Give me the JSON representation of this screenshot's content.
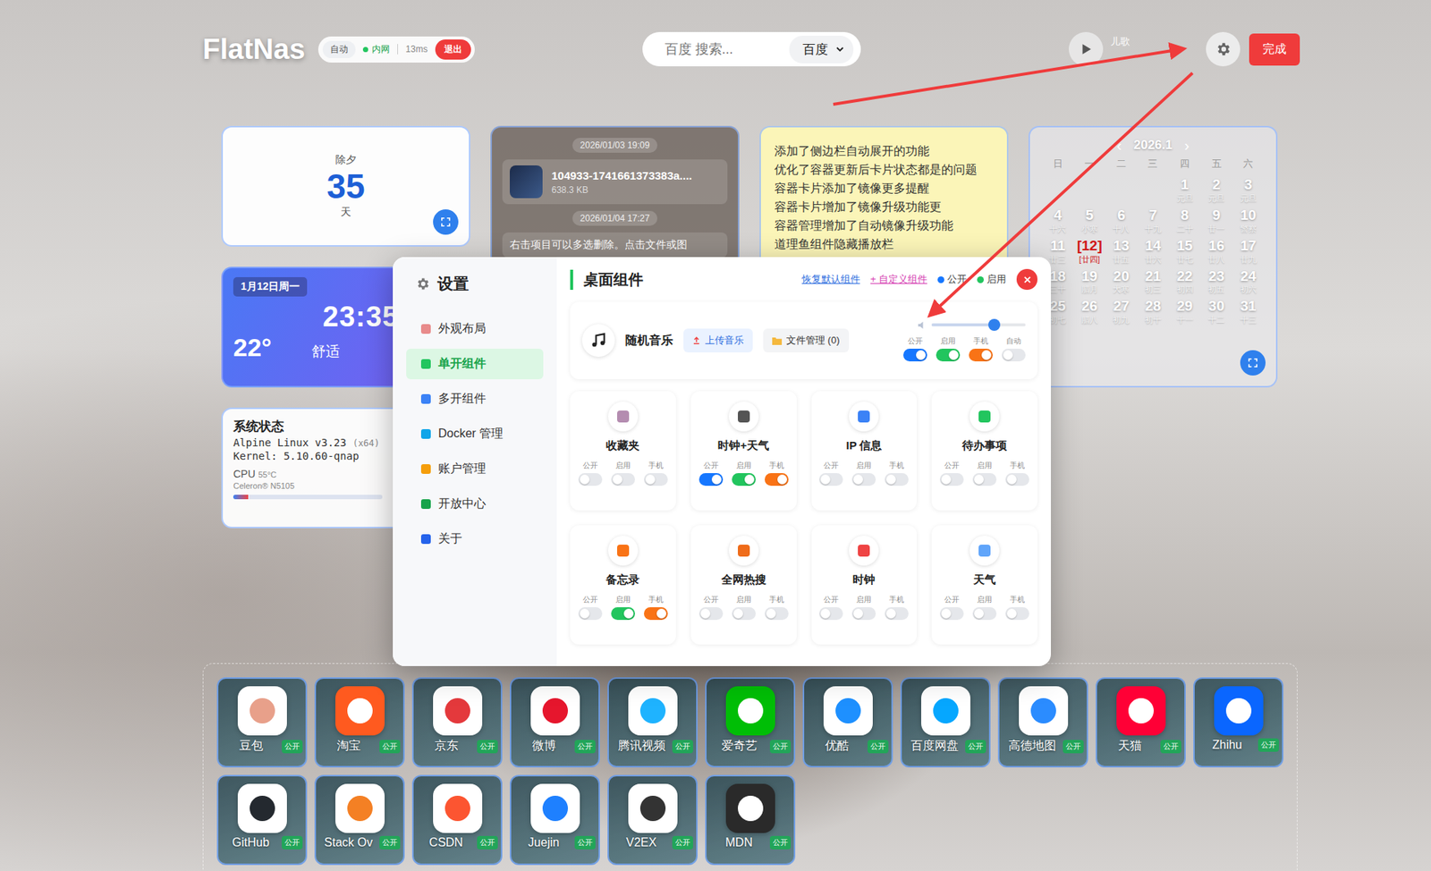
{
  "header": {
    "logo": "FlatNas",
    "status": {
      "mode": "自动",
      "network": "内网",
      "latency": "13ms",
      "logout": "退出"
    },
    "search": {
      "placeholder": "百度 搜索...",
      "engine": "百度"
    },
    "player": {
      "title": "儿歌"
    },
    "done": "完成"
  },
  "countdown": {
    "label": "除夕",
    "days": "35",
    "unit": "天"
  },
  "files": {
    "entries": [
      {
        "kind": "time",
        "text": "2026/01/03 19:09"
      },
      {
        "kind": "file",
        "text": "104933-1741661373383a....",
        "size": "638.3 KB"
      },
      {
        "kind": "time",
        "text": "2026/01/04 17:27"
      },
      {
        "kind": "message",
        "text": "右击项目可以多选删除。点击文件或图"
      }
    ]
  },
  "memo": {
    "lines": [
      "添加了侧边栏自动展开的功能",
      "优化了容器更新后卡片状态都是的问题",
      "容器卡片添加了镜像更多提醒",
      "容器卡片增加了镜像升级功能更",
      "容器管理增加了自动镜像升级功能",
      "道理鱼组件隐藏播放栏"
    ]
  },
  "calendar": {
    "title": "2026.1",
    "prev": "‹",
    "next": "›",
    "weekdays": [
      "日",
      "一",
      "二",
      "三",
      "四",
      "五",
      "六"
    ],
    "offset": 4,
    "days": [
      {
        "day": "1",
        "lunar": "元旦",
        "today": false
      },
      {
        "day": "2",
        "lunar": "元旦",
        "today": false
      },
      {
        "day": "3",
        "lunar": "元旦",
        "today": false
      },
      {
        "day": "4",
        "lunar": "十六",
        "today": false
      },
      {
        "day": "5",
        "lunar": "小寒",
        "today": false
      },
      {
        "day": "6",
        "lunar": "十八",
        "today": false
      },
      {
        "day": "7",
        "lunar": "十九",
        "today": false
      },
      {
        "day": "8",
        "lunar": "二十",
        "today": false
      },
      {
        "day": "9",
        "lunar": "廿一",
        "today": false
      },
      {
        "day": "10",
        "lunar": "警察",
        "today": false
      },
      {
        "day": "11",
        "lunar": "廿三",
        "today": false
      },
      {
        "day": "[12]",
        "lunar": "[廿四]",
        "today": true
      },
      {
        "day": "13",
        "lunar": "廿五",
        "today": false
      },
      {
        "day": "14",
        "lunar": "廿六",
        "today": false
      },
      {
        "day": "15",
        "lunar": "廿七",
        "today": false
      },
      {
        "day": "16",
        "lunar": "廿八",
        "today": false
      },
      {
        "day": "17",
        "lunar": "廿九",
        "today": false
      },
      {
        "day": "18",
        "lunar": "三十",
        "today": false
      },
      {
        "day": "19",
        "lunar": "腊月",
        "today": false
      },
      {
        "day": "20",
        "lunar": "大寒",
        "today": false
      },
      {
        "day": "21",
        "lunar": "初三",
        "today": false
      },
      {
        "day": "22",
        "lunar": "初四",
        "today": false
      },
      {
        "day": "23",
        "lunar": "初五",
        "today": false
      },
      {
        "day": "24",
        "lunar": "初六",
        "today": false
      },
      {
        "day": "25",
        "lunar": "初七",
        "today": false
      },
      {
        "day": "26",
        "lunar": "腊八",
        "today": false
      },
      {
        "day": "27",
        "lunar": "初九",
        "today": false
      },
      {
        "day": "28",
        "lunar": "初十",
        "today": false
      },
      {
        "day": "29",
        "lunar": "十一",
        "today": false
      },
      {
        "day": "30",
        "lunar": "十二",
        "today": false
      },
      {
        "day": "31",
        "lunar": "十三",
        "today": false
      }
    ]
  },
  "clock": {
    "date": "1月12日周一",
    "time": "23:35",
    "temp": "22°",
    "comfort": "舒适"
  },
  "system": {
    "title": "系统状态",
    "os": "Alpine Linux v3.23",
    "arch": "(x64)",
    "kernel": "Kernel: 5.10.60-qnap",
    "cpu_label": "CPU",
    "cpu_temp": "55°C",
    "cpu_model": "Celeron® N5105",
    "cpu_level": 0.1
  },
  "settings": {
    "title": "设置",
    "menu": [
      {
        "label": "外观布局",
        "selected": false,
        "color": "#e88b8b"
      },
      {
        "label": "单开组件",
        "selected": true,
        "color": "#22c55e"
      },
      {
        "label": "多开组件",
        "selected": false,
        "color": "#3b82f6"
      },
      {
        "label": "Docker 管理",
        "selected": false,
        "color": "#0ea5e9"
      },
      {
        "label": "账户管理",
        "selected": false,
        "color": "#f59e0b"
      },
      {
        "label": "开放中心",
        "selected": false,
        "color": "#16a34a"
      },
      {
        "label": "关于",
        "selected": false,
        "color": "#2563eb"
      }
    ],
    "section": "桌面组件",
    "restore": "恢复默认组件",
    "custom": "+ 自定义组件",
    "legend": [
      {
        "label": "公开",
        "color": "#1677ff"
      },
      {
        "label": "启用",
        "color": "#22c55e"
      }
    ],
    "music": {
      "name": "随机音乐",
      "upload": "上传音乐",
      "files": "文件管理 (0)",
      "volume": 0.67,
      "toggles": [
        {
          "label": "公开",
          "on": true
        },
        {
          "label": "启用",
          "on": true
        },
        {
          "label": "手机",
          "on": true
        },
        {
          "label": "自动",
          "on": false
        }
      ]
    },
    "widgets": [
      {
        "name": "收藏夹",
        "color": "#b48cb0",
        "toggles": [
          {
            "label": "公开",
            "on": false
          },
          {
            "label": "启用",
            "on": false
          },
          {
            "label": "手机",
            "on": false
          }
        ]
      },
      {
        "name": "时钟+天气",
        "color": "#555555",
        "toggles": [
          {
            "label": "公开",
            "on": true
          },
          {
            "label": "启用",
            "on": true
          },
          {
            "label": "手机",
            "on": true
          }
        ]
      },
      {
        "name": "IP 信息",
        "color": "#3b82f6",
        "toggles": [
          {
            "label": "公开",
            "on": false
          },
          {
            "label": "启用",
            "on": false
          },
          {
            "label": "手机",
            "on": false
          }
        ]
      },
      {
        "name": "待办事项",
        "color": "#22c55e",
        "toggles": [
          {
            "label": "公开",
            "on": false
          },
          {
            "label": "启用",
            "on": false
          },
          {
            "label": "手机",
            "on": false
          }
        ]
      },
      {
        "name": "备忘录",
        "color": "#f97316",
        "toggles": [
          {
            "label": "公开",
            "on": false
          },
          {
            "label": "启用",
            "on": true
          },
          {
            "label": "手机",
            "on": true
          }
        ]
      },
      {
        "name": "全网热搜",
        "color": "#ef6c1a",
        "toggles": [
          {
            "label": "公开",
            "on": false
          },
          {
            "label": "启用",
            "on": false
          },
          {
            "label": "手机",
            "on": false
          }
        ]
      },
      {
        "name": "时钟",
        "color": "#ef4444",
        "toggles": [
          {
            "label": "公开",
            "on": false
          },
          {
            "label": "启用",
            "on": false
          },
          {
            "label": "手机",
            "on": false
          }
        ]
      },
      {
        "name": "天气",
        "color": "#60a5fa",
        "toggles": [
          {
            "label": "公开",
            "on": false
          },
          {
            "label": "启用",
            "on": false
          },
          {
            "label": "手机",
            "on": false
          }
        ]
      }
    ]
  },
  "apps": [
    {
      "name": "豆包",
      "badge": "公开",
      "color": "#e8a08a",
      "kind": "mark"
    },
    {
      "name": "淘宝",
      "badge": "公开",
      "color": "#ff5a1f",
      "kind": "solid"
    },
    {
      "name": "京东",
      "badge": "公开",
      "color": "#e4393c",
      "kind": "mark"
    },
    {
      "name": "微博",
      "badge": "公开",
      "color": "#e6162d",
      "kind": "mark"
    },
    {
      "name": "腾讯视频",
      "badge": "公开",
      "color": "#1fb3ff",
      "kind": "mark"
    },
    {
      "name": "爱奇艺",
      "badge": "公开",
      "color": "#00be06",
      "kind": "solid"
    },
    {
      "name": "优酷",
      "badge": "公开",
      "color": "#1e90ff",
      "kind": "mark"
    },
    {
      "name": "百度网盘",
      "badge": "公开",
      "color": "#06a7ff",
      "kind": "mark"
    },
    {
      "name": "高德地图",
      "badge": "公开",
      "color": "#2b8cff",
      "kind": "mark"
    },
    {
      "name": "天猫",
      "badge": "公开",
      "color": "#ff0036",
      "kind": "solid"
    },
    {
      "name": "Zhihu",
      "badge": "公开",
      "color": "#0a66ff",
      "kind": "solid"
    },
    {
      "name": "GitHub",
      "badge": "公开",
      "color": "#24292f",
      "kind": "mark"
    },
    {
      "name": "Stack Ov",
      "badge": "公开",
      "color": "#f48024",
      "kind": "mark"
    },
    {
      "name": "CSDN",
      "badge": "公开",
      "color": "#fc5531",
      "kind": "mark"
    },
    {
      "name": "Juejin",
      "badge": "公开",
      "color": "#1e80ff",
      "kind": "mark"
    },
    {
      "name": "V2EX",
      "badge": "公开",
      "color": "#333333",
      "kind": "mark"
    },
    {
      "name": "MDN",
      "badge": "公开",
      "color": "#2a2a2a",
      "kind": "solid"
    }
  ]
}
